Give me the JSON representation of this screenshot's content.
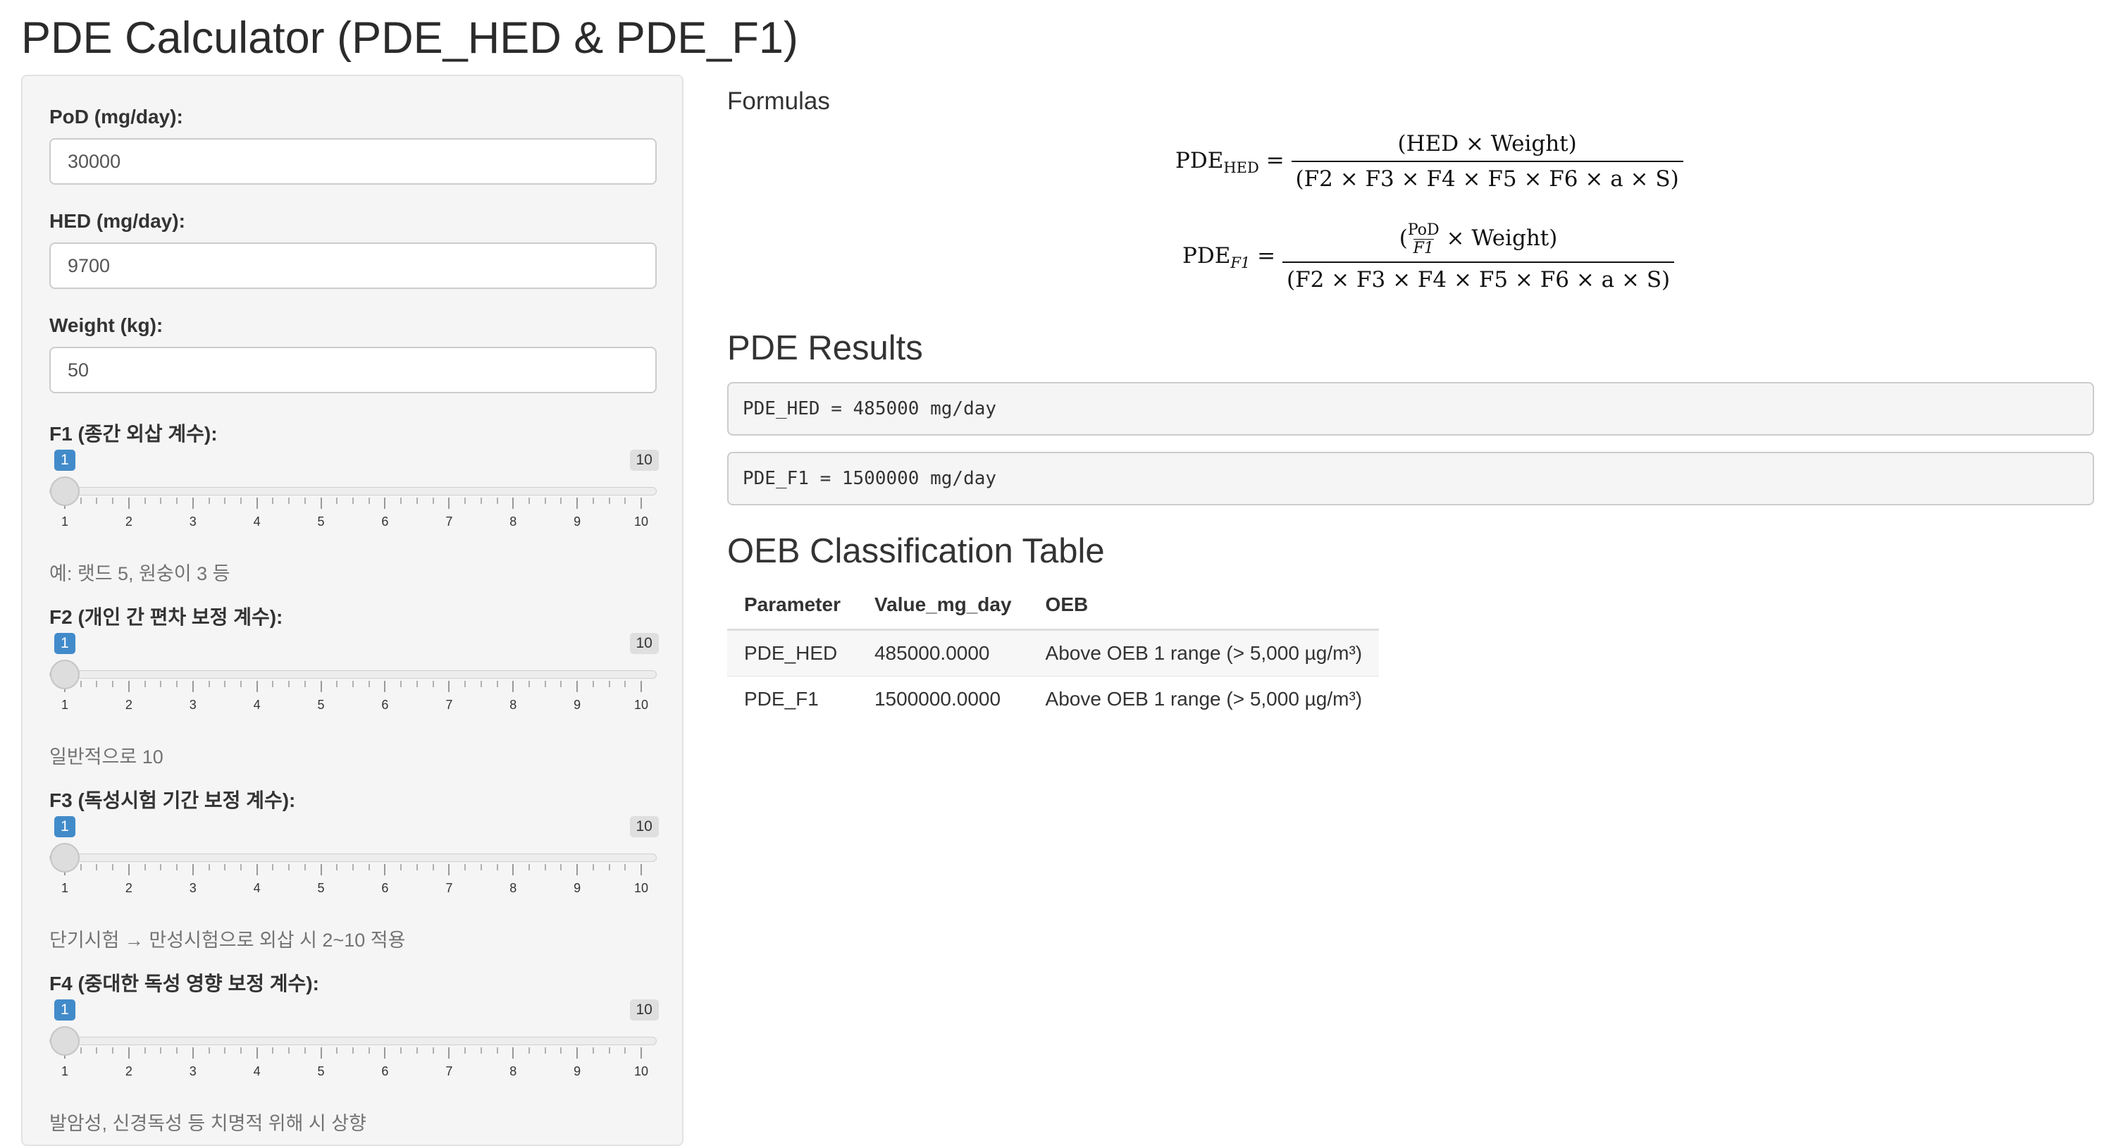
{
  "app_title": "PDE Calculator (PDE_HED & PDE_F1)",
  "inputs": {
    "pod": {
      "label": "PoD (mg/day):",
      "value": "30000"
    },
    "hed": {
      "label": "HED (mg/day):",
      "value": "9700"
    },
    "weight": {
      "label": "Weight (kg):",
      "value": "50"
    }
  },
  "sliders": [
    {
      "label": "F1 (종간 외삽 계수):",
      "value": "1",
      "min": 1,
      "max": "10",
      "help": "예: 랫드 5, 원숭이 3 등"
    },
    {
      "label": "F2 (개인 간 편차 보정 계수):",
      "value": "1",
      "min": 1,
      "max": "10",
      "help": "일반적으로 10"
    },
    {
      "label": "F3 (독성시험 기간 보정 계수):",
      "value": "1",
      "min": 1,
      "max": "10",
      "help": "단기시험 → 만성시험으로 외삽 시 2~10 적용"
    },
    {
      "label": "F4 (중대한 독성 영향 보정 계수):",
      "value": "1",
      "min": 1,
      "max": "10",
      "help": "발암성, 신경독성 등 치명적 위해 시 상향"
    }
  ],
  "slider_tick_labels": [
    "1",
    "2",
    "3",
    "4",
    "5",
    "6",
    "7",
    "8",
    "9",
    "10"
  ],
  "formulas": {
    "heading": "Formulas",
    "hed_lhs": "PDE",
    "hed_sub": "HED",
    "hed_num": "(HED × Weight)",
    "hed_den": "(F2 × F3 × F4 × F5 × F6 × a × S)",
    "f1_lhs": "PDE",
    "f1_sub": "F1",
    "f1_num_a": "PoD",
    "f1_num_b": "F1",
    "f1_num_c": "× Weight",
    "f1_den": "(F2 × F3 × F4 × F5 × F6 × a × S)"
  },
  "results": {
    "heading": "PDE Results",
    "pde_hed": "PDE_HED = 485000 mg/day",
    "pde_f1": "PDE_F1 = 1500000 mg/day"
  },
  "oeb_table": {
    "heading": "OEB Classification Table",
    "columns": [
      "Parameter",
      "Value_mg_day",
      "OEB"
    ],
    "rows": [
      [
        "PDE_HED",
        "485000.0000",
        "Above OEB 1 range (> 5,000 µg/m³)"
      ],
      [
        "PDE_F1",
        "1500000.0000",
        "Above OEB 1 range (> 5,000 µg/m³)"
      ]
    ]
  }
}
